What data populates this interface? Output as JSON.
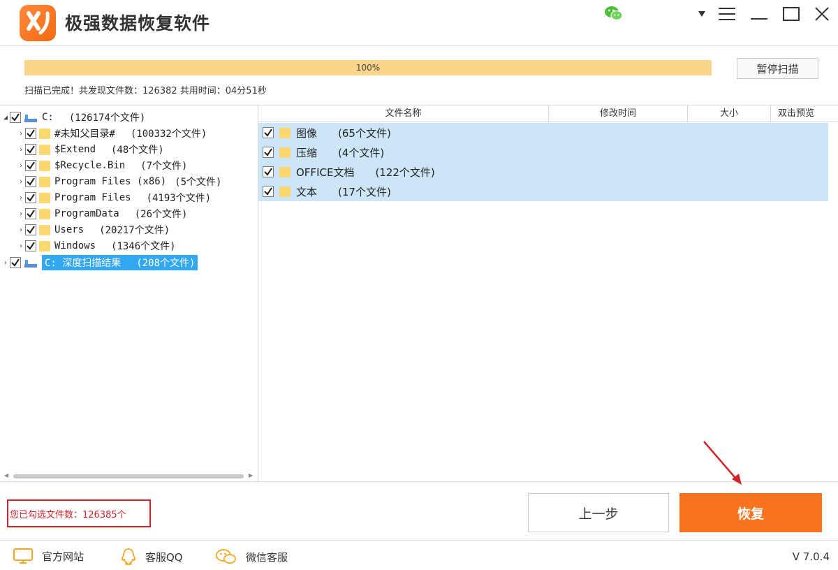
{
  "app": {
    "title": "极强数据恢复软件",
    "version": "V 7.0.4"
  },
  "scan": {
    "progress_percent": 100,
    "progress_label": "100%",
    "pause_label": "暂停扫描",
    "status_text": "扫描已完成！共发现文件数：126382  共用时间：04分51秒"
  },
  "tree": [
    {
      "name": "C:",
      "count": "(126174个文件)",
      "icon": "drive-icon"
    },
    {
      "name": "#未知父目录#",
      "count": "(100332个文件)",
      "icon": "folder-icon"
    },
    {
      "name": "$Extend",
      "count": "(48个文件)",
      "icon": "folder-icon"
    },
    {
      "name": "$Recycle.Bin",
      "count": "(7个文件)",
      "icon": "folder-icon"
    },
    {
      "name": "Program Files (x86)",
      "count": "(5个文件)",
      "icon": "folder-icon"
    },
    {
      "name": "Program Files",
      "count": "(4193个文件)",
      "icon": "folder-icon"
    },
    {
      "name": "ProgramData",
      "count": "(26个文件)",
      "icon": "folder-icon"
    },
    {
      "name": "Users",
      "count": "(20217个文件)",
      "icon": "folder-icon"
    },
    {
      "name": "Windows",
      "count": "(1346个文件)",
      "icon": "folder-icon"
    },
    {
      "name": "C: 深度扫描结果",
      "count": "(208个文件)",
      "icon": "drive-icon"
    }
  ],
  "list": {
    "columns": [
      "文件名称",
      "修改时间",
      "大小",
      "双击预览"
    ],
    "rows": [
      {
        "name": "图像",
        "count": "(65个文件)"
      },
      {
        "name": "压缩",
        "count": "(4个文件)"
      },
      {
        "name": "OFFICE文档",
        "count": "(122个文件)"
      },
      {
        "name": "文本",
        "count": "(17个文件)"
      }
    ]
  },
  "actions": {
    "selected_text": "您已勾选文件数：126385个",
    "prev_label": "上一步",
    "recover_label": "恢复"
  },
  "footer": {
    "website": "官方网站",
    "qq": "客服QQ",
    "wechat": "微信客服"
  },
  "colors": {
    "accent_orange": "#f8731f",
    "progress_yellow": "#fbd68a",
    "selection_blue": "#33a7f0",
    "row_blue": "#cde6f7",
    "highlight_red": "#d0232a"
  }
}
